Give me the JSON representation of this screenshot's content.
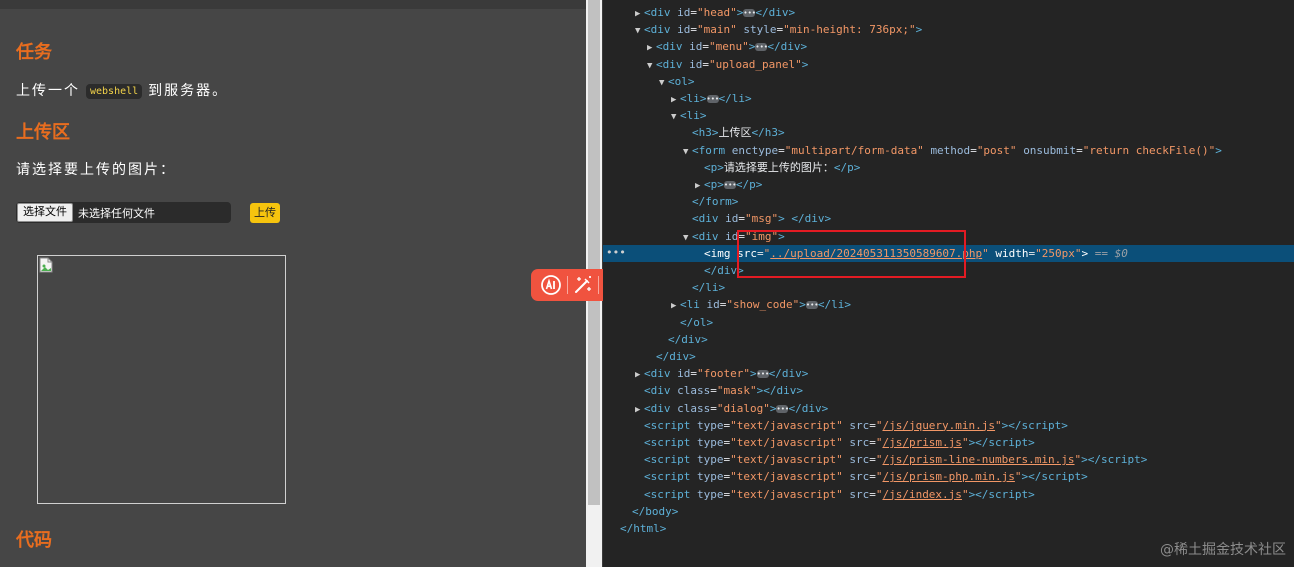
{
  "page": {
    "task_heading": "任务",
    "task_text_before": "上传一个",
    "task_code": "webshell",
    "task_text_after": "到服务器。",
    "upload_heading": "上传区",
    "upload_prompt": "请选择要上传的图片：",
    "file_button_label": "选择文件",
    "file_status": "未选择任何文件",
    "upload_button_label": "上传",
    "code_heading": "代码"
  },
  "devtools": {
    "selected_marker": "== $0",
    "lines": [
      {
        "indent": 1,
        "tri": "▶",
        "html": "<span class='tag'>&lt;div</span> <span class='attr'>id</span>=<span class='val'>\"head\"</span><span class='tag'>&gt;</span><span class='ell'>•••</span><span class='tag'>&lt;/div&gt;</span>"
      },
      {
        "indent": 1,
        "tri": "▼",
        "html": "<span class='tag'>&lt;div</span> <span class='attr'>id</span>=<span class='val'>\"main\"</span> <span class='attr'>style</span>=<span class='val'>\"min-height: 736px;\"</span><span class='tag'>&gt;</span>"
      },
      {
        "indent": 2,
        "tri": "▶",
        "html": "<span class='tag'>&lt;div</span> <span class='attr'>id</span>=<span class='val'>\"menu\"</span><span class='tag'>&gt;</span><span class='ell'>•••</span><span class='tag'>&lt;/div&gt;</span>"
      },
      {
        "indent": 2,
        "tri": "▼",
        "html": "<span class='tag'>&lt;div</span> <span class='attr'>id</span>=<span class='val'>\"upload_panel\"</span><span class='tag'>&gt;</span>"
      },
      {
        "indent": 3,
        "tri": "▼",
        "html": "<span class='tag'>&lt;ol&gt;</span>"
      },
      {
        "indent": 4,
        "tri": "▶",
        "html": "<span class='tag'>&lt;li&gt;</span><span class='ell'>•••</span><span class='tag'>&lt;/li&gt;</span>"
      },
      {
        "indent": 4,
        "tri": "▼",
        "html": "<span class='tag'>&lt;li&gt;</span>"
      },
      {
        "indent": 5,
        "tri": "",
        "html": "<span class='tag'>&lt;h3&gt;</span><span class='txt'>上传区</span><span class='tag'>&lt;/h3&gt;</span>"
      },
      {
        "indent": 5,
        "tri": "▼",
        "html": "<span class='tag'>&lt;form</span> <span class='attr'>enctype</span>=<span class='val'>\"multipart/form-data\"</span> <span class='attr'>method</span>=<span class='val'>\"post\"</span> <span class='attr'>onsubmit</span>=<span class='val'>\"return checkFile()\"</span><span class='tag'>&gt;</span>"
      },
      {
        "indent": 6,
        "tri": "",
        "html": "<span class='tag'>&lt;p&gt;</span><span class='txt'>请选择要上传的图片：</span><span class='tag'>&lt;/p&gt;</span>"
      },
      {
        "indent": 6,
        "tri": "▶",
        "html": "<span class='tag'>&lt;p&gt;</span><span class='ell'>•••</span><span class='tag'>&lt;/p&gt;</span>"
      },
      {
        "indent": 5,
        "tri": "",
        "html": "<span class='tag'>&lt;/form&gt;</span>"
      },
      {
        "indent": 5,
        "tri": "",
        "html": "<span class='tag'>&lt;div</span> <span class='attr'>id</span>=<span class='val'>\"msg\"</span><span class='tag'>&gt;</span> <span class='tag'>&lt;/div&gt;</span>"
      },
      {
        "indent": 5,
        "tri": "▼",
        "html": "<span class='tag'>&lt;div</span> <span class='attr'>id</span>=<span class='val'>\"img\"</span><span class='tag'>&gt;</span>"
      },
      {
        "indent": 6,
        "tri": "",
        "selected": true,
        "html": "<span class='tag'>&lt;img</span> <span class='attr'>src</span>=<span class='val'>\"</span><span class='link'>../upload/202405311350589607.php</span><span class='val'>\"</span> <span class='attr'>width</span>=<span class='val'>\"250px\"</span><span class='tag'>&gt;</span> <span class='eq0'>== $0</span>"
      },
      {
        "indent": 6,
        "tri": "",
        "html": "<span class='tag'>&lt;/div&gt;</span>"
      },
      {
        "indent": 5,
        "tri": "",
        "html": "<span class='tag'>&lt;/li&gt;</span>"
      },
      {
        "indent": 4,
        "tri": "▶",
        "html": "<span class='tag'>&lt;li</span> <span class='attr'>id</span>=<span class='val'>\"show_code\"</span><span class='tag'>&gt;</span><span class='ell'>•••</span><span class='tag'>&lt;/li&gt;</span>"
      },
      {
        "indent": 4,
        "tri": "",
        "html": "<span class='tag'>&lt;/ol&gt;</span>"
      },
      {
        "indent": 3,
        "tri": "",
        "html": "<span class='tag'>&lt;/div&gt;</span>"
      },
      {
        "indent": 2,
        "tri": "",
        "html": "<span class='tag'>&lt;/div&gt;</span>"
      },
      {
        "indent": 1,
        "tri": "▶",
        "html": "<span class='tag'>&lt;div</span> <span class='attr'>id</span>=<span class='val'>\"footer\"</span><span class='tag'>&gt;</span><span class='ell'>•••</span><span class='tag'>&lt;/div&gt;</span>"
      },
      {
        "indent": 1,
        "tri": "",
        "html": "<span class='tag'>&lt;div</span> <span class='attr'>class</span>=<span class='val'>\"mask\"</span><span class='tag'>&gt;</span><span class='tag'>&lt;/div&gt;</span>"
      },
      {
        "indent": 1,
        "tri": "▶",
        "html": "<span class='tag'>&lt;div</span> <span class='attr'>class</span>=<span class='val'>\"dialog\"</span><span class='tag'>&gt;</span><span class='ell'>•••</span><span class='tag'>&lt;/div&gt;</span>"
      },
      {
        "indent": 1,
        "tri": "",
        "html": "<span class='tag'>&lt;script</span> <span class='attr'>type</span>=<span class='val'>\"text/javascript\"</span> <span class='attr'>src</span>=<span class='val'>\"</span><span class='link'>/js/jquery.min.js</span><span class='val'>\"</span><span class='tag'>&gt;&lt;/script&gt;</span>"
      },
      {
        "indent": 1,
        "tri": "",
        "html": "<span class='tag'>&lt;script</span> <span class='attr'>type</span>=<span class='val'>\"text/javascript\"</span> <span class='attr'>src</span>=<span class='val'>\"</span><span class='link'>/js/prism.js</span><span class='val'>\"</span><span class='tag'>&gt;&lt;/script&gt;</span>"
      },
      {
        "indent": 1,
        "tri": "",
        "html": "<span class='tag'>&lt;script</span> <span class='attr'>type</span>=<span class='val'>\"text/javascript\"</span> <span class='attr'>src</span>=<span class='val'>\"</span><span class='link'>/js/prism-line-numbers.min.js</span><span class='val'>\"</span><span class='tag'>&gt;&lt;/script&gt;</span>"
      },
      {
        "indent": 1,
        "tri": "",
        "html": "<span class='tag'>&lt;script</span> <span class='attr'>type</span>=<span class='val'>\"text/javascript\"</span> <span class='attr'>src</span>=<span class='val'>\"</span><span class='link'>/js/prism-php.min.js</span><span class='val'>\"</span><span class='tag'>&gt;&lt;/script&gt;</span>"
      },
      {
        "indent": 1,
        "tri": "",
        "html": "<span class='tag'>&lt;script</span> <span class='attr'>type</span>=<span class='val'>\"text/javascript\"</span> <span class='attr'>src</span>=<span class='val'>\"</span><span class='link'>/js/index.js</span><span class='val'>\"</span><span class='tag'>&gt;&lt;/script&gt;</span>"
      },
      {
        "indent": 0,
        "tri": "",
        "html": "<span class='tag'>&lt;/body&gt;</span>"
      },
      {
        "indent": -1,
        "tri": "",
        "html": "<span class='tag'>&lt;/html&gt;</span>"
      }
    ]
  },
  "watermark": "@稀土掘金技术社区",
  "colors": {
    "heading": "#e86d1f",
    "upload_button": "#f6c40e",
    "toolbar": "#f0533f",
    "selected_row": "#0b4f79",
    "highlight_box": "#e31b23"
  }
}
